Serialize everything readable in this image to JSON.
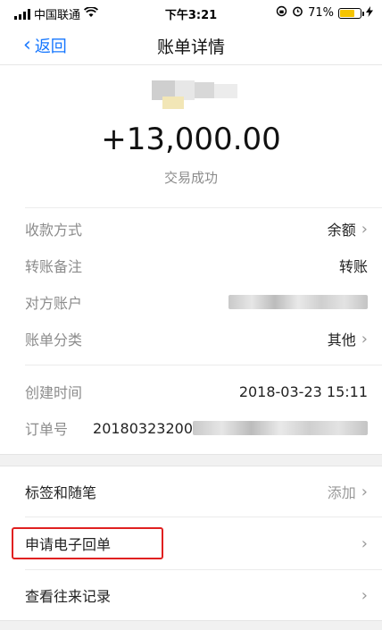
{
  "status_bar": {
    "carrier": "中国联通",
    "time": "下午3:21",
    "battery": "71%",
    "battery_level": 0.71
  },
  "nav": {
    "back_label": "返回",
    "title": "账单详情"
  },
  "summary": {
    "amount": "+13,000.00",
    "status": "交易成功"
  },
  "details": {
    "method_label": "收款方式",
    "method_value": "余额",
    "note_label": "转账备注",
    "note_value": "转账",
    "counterparty_label": "对方账户",
    "category_label": "账单分类",
    "category_value": "其他",
    "created_label": "创建时间",
    "created_value": "2018-03-23 15:11",
    "order_label": "订单号",
    "order_value": "20180323200"
  },
  "menu": {
    "tags_label": "标签和随笔",
    "tags_action": "添加",
    "receipt_label": "申请电子回单",
    "history_label": "查看往来记录"
  },
  "colors": {
    "accent": "#1677ff",
    "highlight": "#e02020",
    "muted": "#8c8c8c"
  }
}
